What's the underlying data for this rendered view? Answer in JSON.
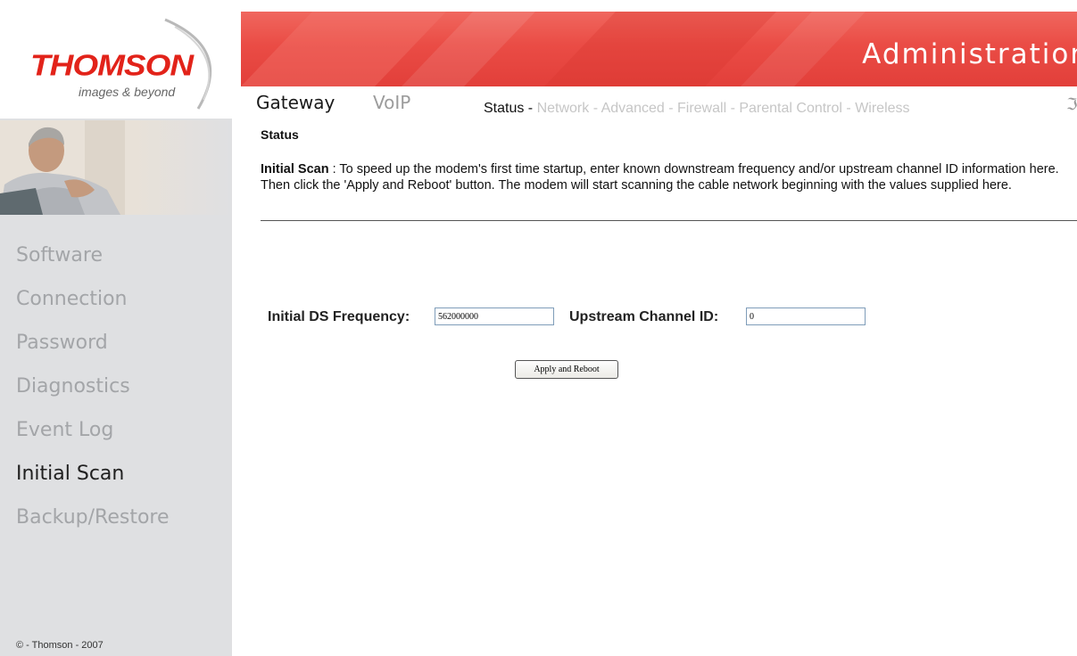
{
  "brand": {
    "name": "THOMSON",
    "tagline": "images & beyond"
  },
  "banner": {
    "title": "Administration"
  },
  "top_tabs": [
    {
      "label": "Gateway",
      "active": true
    },
    {
      "label": "VoIP",
      "active": false
    }
  ],
  "sub_nav": {
    "items": [
      {
        "label": "Status",
        "active": true
      },
      {
        "label": "Network",
        "active": false
      },
      {
        "label": "Advanced",
        "active": false
      },
      {
        "label": "Firewall",
        "active": false
      },
      {
        "label": "Parental Control",
        "active": false
      },
      {
        "label": "Wireless",
        "active": false
      }
    ],
    "separator": " - "
  },
  "sidebar": {
    "items": [
      {
        "label": "Software",
        "active": false
      },
      {
        "label": "Connection",
        "active": false
      },
      {
        "label": "Password",
        "active": false
      },
      {
        "label": "Diagnostics",
        "active": false
      },
      {
        "label": "Event Log",
        "active": false
      },
      {
        "label": "Initial Scan",
        "active": true
      },
      {
        "label": "Backup/Restore",
        "active": false
      }
    ],
    "copyright": "© - Thomson - 2007"
  },
  "content": {
    "page_title": "Status",
    "description_heading": "Initial Scan",
    "description_text": " :  To speed up the modem's first time startup, enter known downstream frequency and/or upstream channel ID information here. Then click the 'Apply and Reboot' button. The modem will start scanning the cable network beginning with the values supplied here.",
    "ds_frequency": {
      "label": "Initial DS Frequency:",
      "value": "562000000"
    },
    "upstream_channel": {
      "label": "Upstream Channel ID:",
      "value": "0"
    },
    "apply_button": "Apply and Reboot"
  },
  "colors": {
    "accent_red": "#e2231a",
    "banner_red": "#ea4c45",
    "sidebar_bg": "#dfe0e2",
    "menu_inactive": "#a3a5a8",
    "menu_active": "#202020"
  }
}
